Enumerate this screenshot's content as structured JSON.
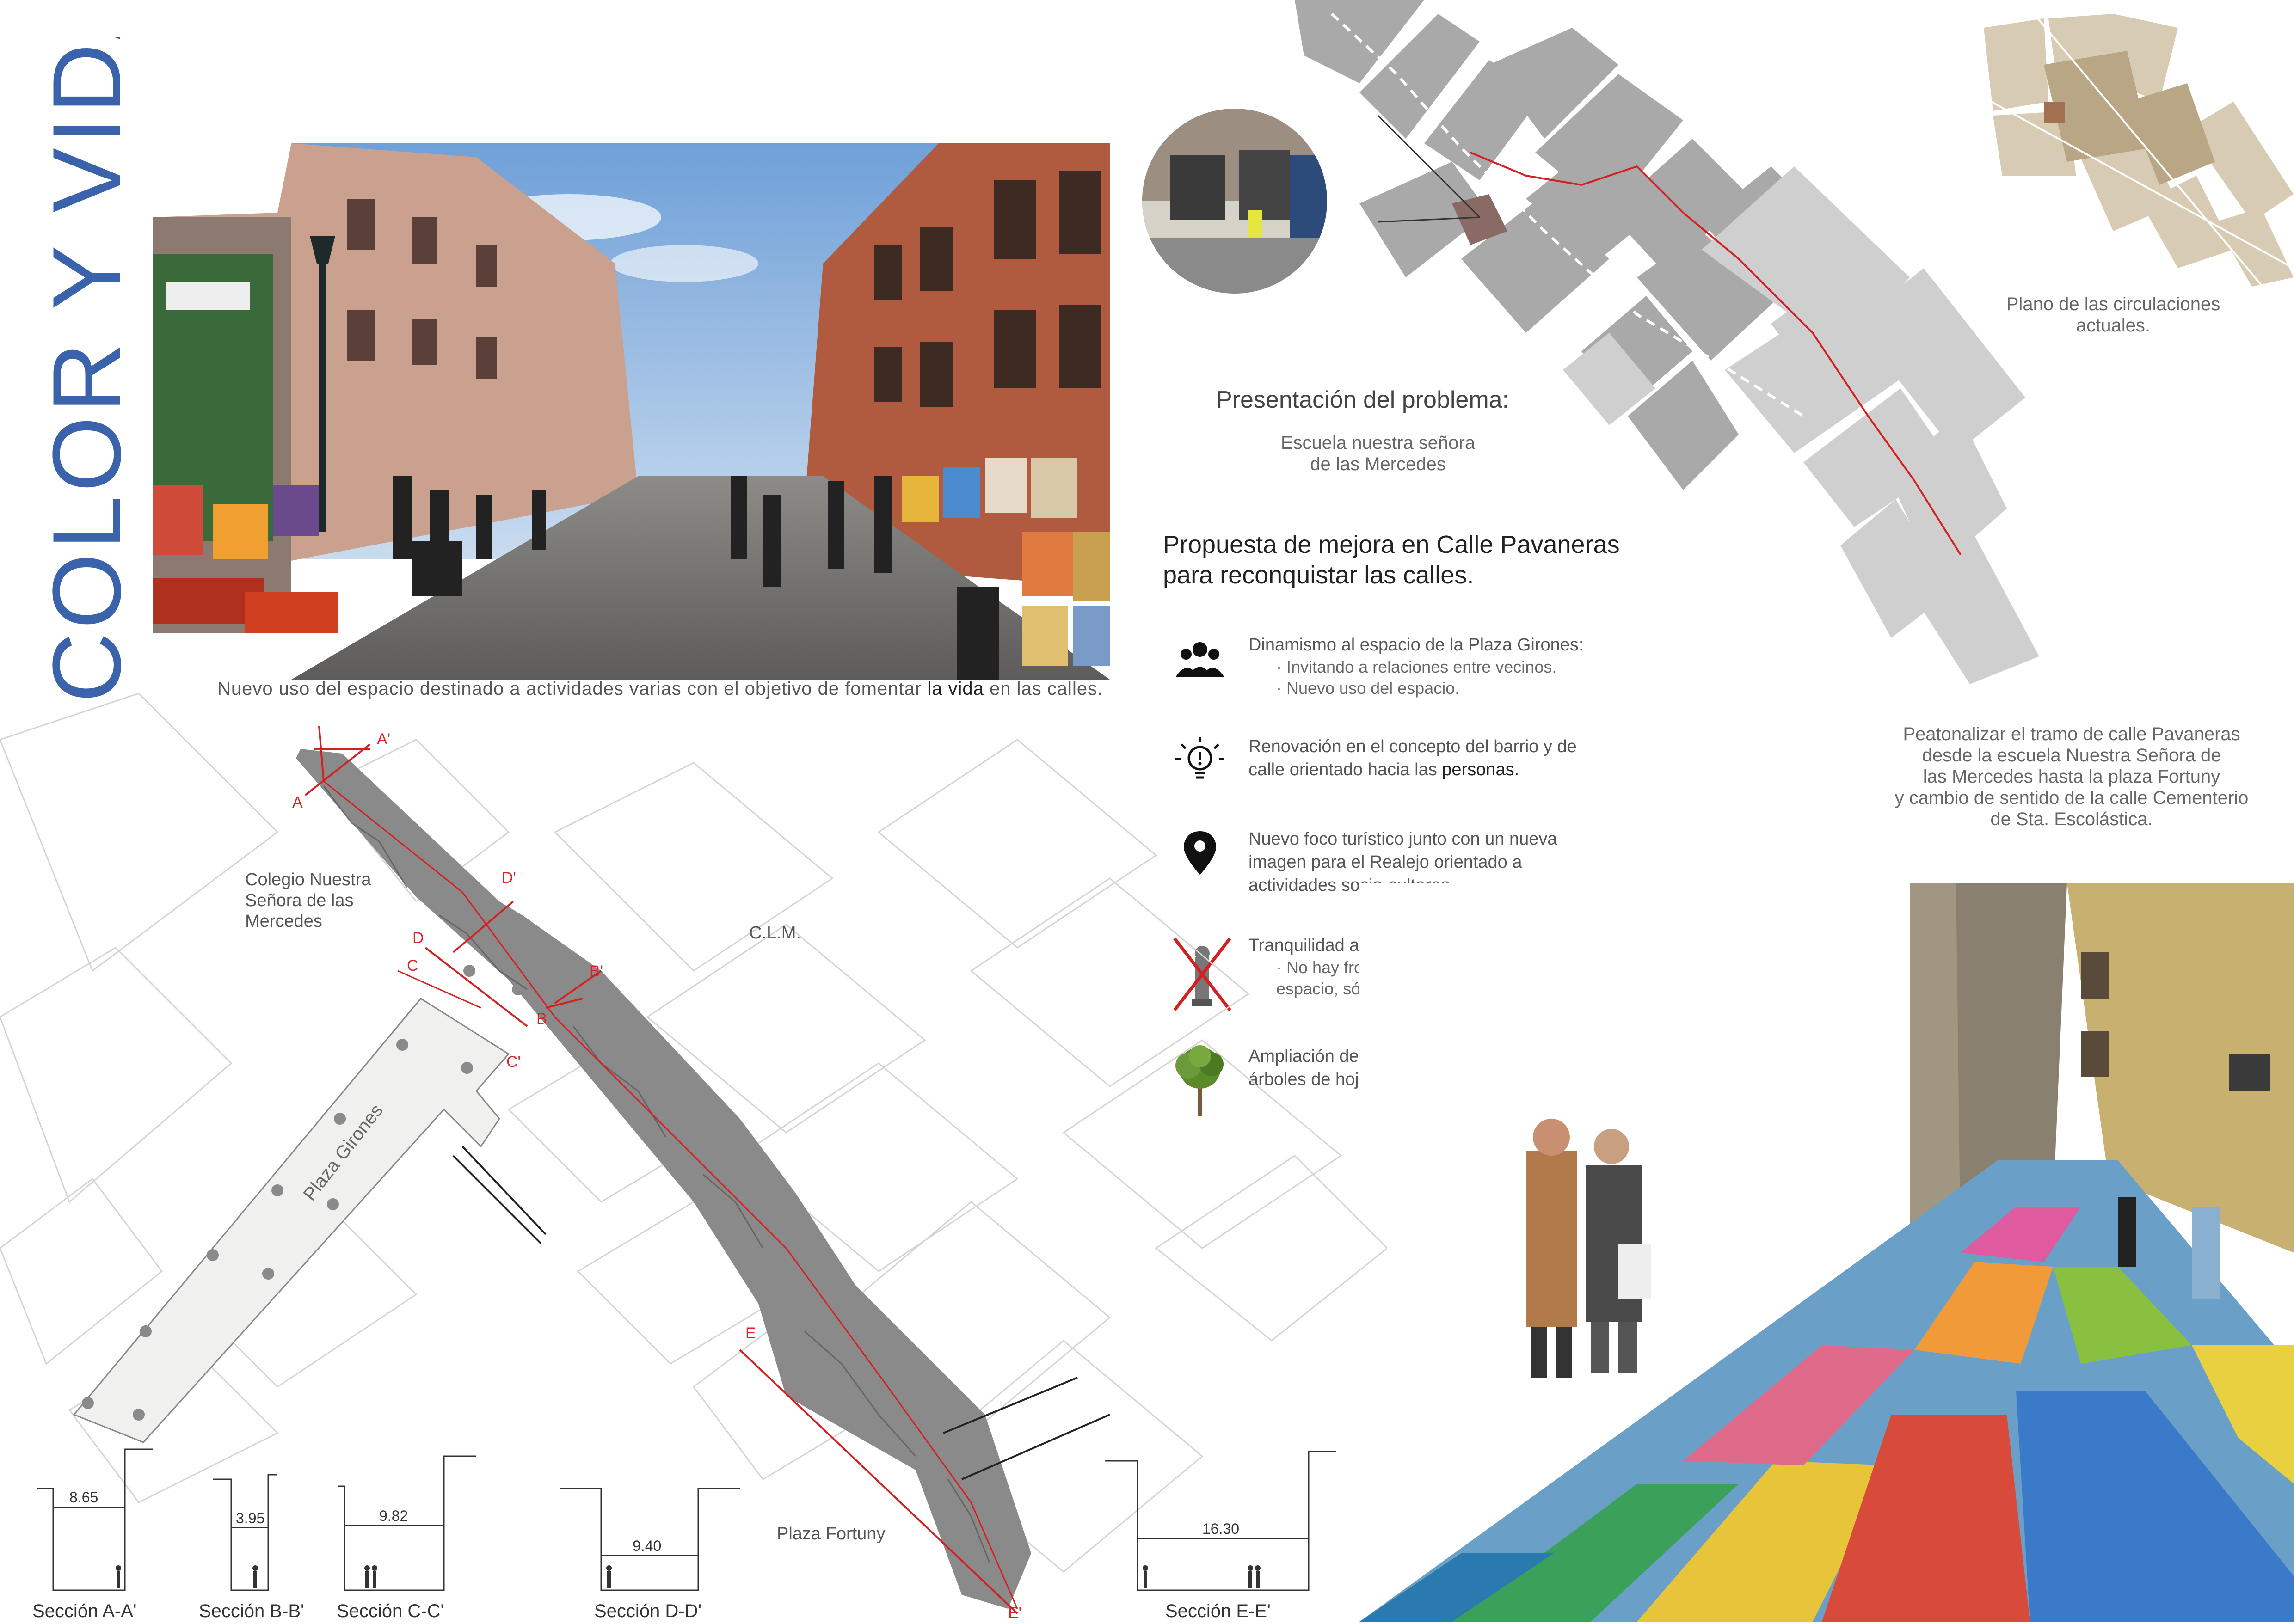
{
  "title": "COLOR Y VIDA",
  "photo_caption": {
    "before": "Nuevo uso del espacio destinado a actividades varias con el objetivo de fomentar ",
    "highlight": "la vida",
    "after": " en las calles."
  },
  "problem": {
    "heading": "Presentación del problema:",
    "subtitle_line1": "Escuela nuestra señora",
    "subtitle_line2": "de las Mercedes"
  },
  "circulation_plan": {
    "line1": "Plano de las circulaciones",
    "line2": "actuales."
  },
  "proposal": {
    "line1": "Propuesta de mejora en Calle Pavaneras",
    "line2": "para reconquistar las calles."
  },
  "features": [
    {
      "icon": "group-icon",
      "title": "Dinamismo al espacio de la Plaza Girones:",
      "sub1": "· Invitando a relaciones entre vecinos.",
      "sub2": "· Nuevo uso del espacio."
    },
    {
      "icon": "lightbulb-icon",
      "title_line1": "Renovación en el concepto del barrio y de",
      "title_line2_before": "calle orientado hacia las ",
      "title_line2_highlight": "personas."
    },
    {
      "icon": "location-pin-icon",
      "title_line1": "Nuevo foco turístico junto con un nueva",
      "title_line2": "imagen para el Realejo orientado a",
      "title_line3": "actividades socio-cultares."
    },
    {
      "icon": "crossed-bollard-icon",
      "title": "Tranquilidad al recorrer las calles:",
      "sub1": "· No hay fronteras ni límites que nos dividan el",
      "sub2": "espacio, sólo libertad para pasearlas."
    },
    {
      "icon": "orange-tree-icon",
      "title_line1": "Ampliación de los alcorques existentes con",
      "title_line2": "árboles de hoja perenne: naranjos."
    }
  ],
  "pedestrian_note": {
    "line1": "Peatonalizar el tramo de calle Pavaneras",
    "line2": "desde la escuela Nuestra Señora de",
    "line3": "las Mercedes  hasta la plaza Fortuny",
    "line4": "y cambio de sentido de la calle Cementerio",
    "line5": "de Sta. Escolástica."
  },
  "map_labels": {
    "school_line1": "Colegio Nuestra",
    "school_line2": "Señora de las",
    "school_line3": "Mercedes",
    "clm": "C.L.M.",
    "plaza_girones": "Plaza Girones",
    "plaza_fortuny": "Plaza Fortuny"
  },
  "section_marks": [
    "A",
    "A'",
    "B",
    "B'",
    "C",
    "C'",
    "D",
    "D'",
    "E",
    "E'"
  ],
  "sections": [
    {
      "label": "Sección A-A'",
      "width": "8.65"
    },
    {
      "label": "Sección B-B'",
      "width": "3.95"
    },
    {
      "label": "Sección C-C'",
      "width": "9.82"
    },
    {
      "label": "Sección D-D'",
      "width": "9.40"
    },
    {
      "label": "Sección E-E'",
      "width": "16.30"
    }
  ],
  "colors": {
    "title_blue": "#3b63ac",
    "section_red": "#d42020",
    "building_gray": "#a9a9a9",
    "plan_beige": "#d8cbb3"
  }
}
